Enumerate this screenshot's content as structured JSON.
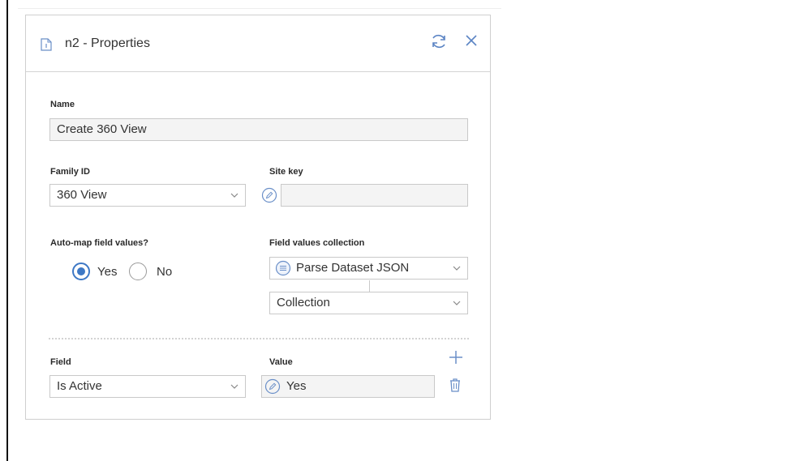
{
  "panel": {
    "title": "n2 - Properties",
    "icons": {
      "document": "document-icon",
      "refresh": "refresh-icon",
      "close": "close-icon"
    }
  },
  "fields": {
    "name": {
      "label": "Name",
      "value": "Create 360 View"
    },
    "family_id": {
      "label": "Family ID",
      "value": "360 View"
    },
    "site_key": {
      "label": "Site key",
      "value": ""
    },
    "auto_map": {
      "label": "Auto-map field values?",
      "options": [
        {
          "label": "Yes",
          "selected": true
        },
        {
          "label": "No",
          "selected": false
        }
      ]
    },
    "field_values_collection": {
      "label": "Field values collection",
      "source": "Parse Dataset JSON",
      "collection": "Collection"
    }
  },
  "mapping": {
    "field_label": "Field",
    "value_label": "Value",
    "row": {
      "field": "Is Active",
      "value": "Yes"
    }
  },
  "colors": {
    "accent": "#3d78c5",
    "icon": "#6a8fc8",
    "border": "#c9c9c9"
  }
}
